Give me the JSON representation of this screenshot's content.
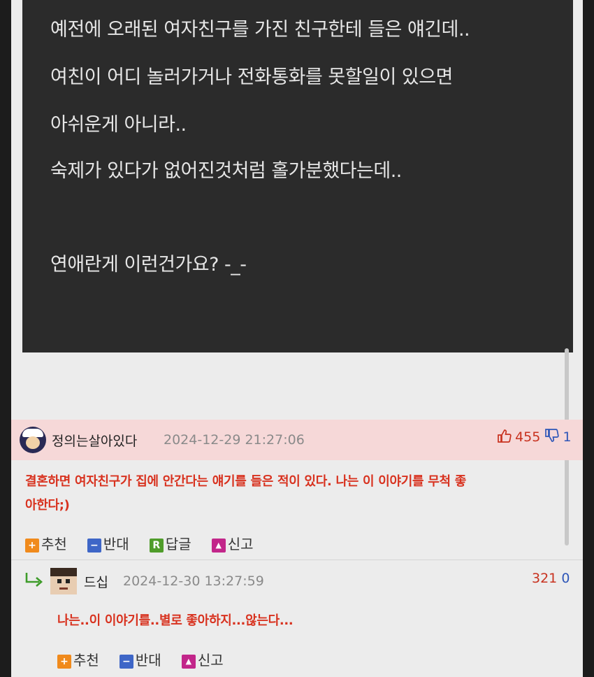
{
  "post": {
    "lines": [
      "예전에 오래된 여자친구를 가진 친구한테 들은 얘긴데..",
      "여친이 어디 놀러가거나 전화통화를 못할일이 있으면",
      "아쉬운게 아니라..",
      "숙제가 있다가 없어진것처럼 홀가분했다는데..",
      "연애란게 이런건가요? -_-"
    ]
  },
  "comments": [
    {
      "nickname": "정의는살아있다",
      "date": "2024-12-29 21:27:06",
      "upvotes": "455",
      "downvotes": "1",
      "text_line1": "결혼하면 여자친구가 집에 안간다는 얘기를 들은 적이 있다. 나는 이 이야기를 무척 좋",
      "text_line2": "아한다;)",
      "actions": {
        "recommend": "추천",
        "oppose": "반대",
        "reply": "답글",
        "report": "신고"
      }
    },
    {
      "nickname": "드십",
      "date": "2024-12-30 13:27:59",
      "upvotes": "321",
      "downvotes": "0",
      "text": "나는..이 이야기를..별로 좋아하지...않는다...",
      "actions": {
        "recommend": "추천",
        "oppose": "반대",
        "report": "신고"
      }
    }
  ],
  "colors": {
    "post_bg": "#2b2b2b",
    "comment_highlight": "#f6d8d8",
    "comment_text": "#d8321f",
    "upvote": "#c8321f",
    "downvote": "#2e56b8"
  },
  "icons": {
    "thumbs_up": "thumbs-up-icon",
    "thumbs_down": "thumbs-down-icon",
    "reply_arrow": "reply-arrow-icon"
  }
}
